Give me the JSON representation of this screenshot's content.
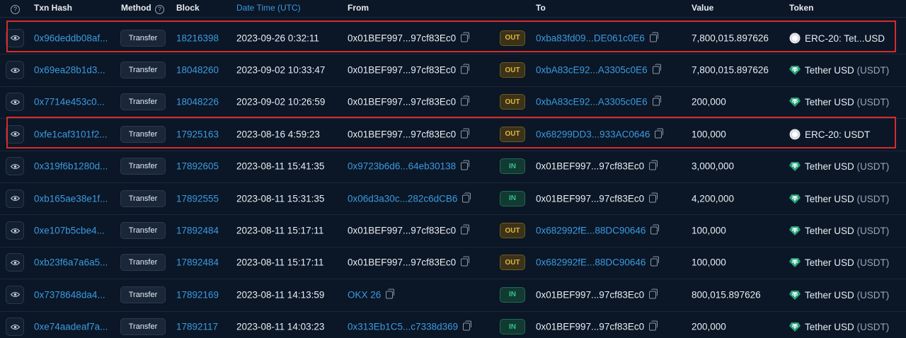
{
  "headers": {
    "help_icon": "question-circle-icon",
    "txn_hash": "Txn Hash",
    "method": "Method",
    "block": "Block",
    "date_time": "Date Time (UTC)",
    "from": "From",
    "to": "To",
    "value": "Value",
    "token": "Token"
  },
  "colors": {
    "link": "#3a9be0",
    "out_badge": "#e3b341",
    "in_badge": "#2fc29a",
    "highlight": "#d62b2b",
    "tether": "#26a17b"
  },
  "rows": [
    {
      "hash": "0x96deddb08af...",
      "method": "Transfer",
      "block": "18216398",
      "datetime": "2023-09-26 0:32:11",
      "from": "0x01BEF997...97cf83Ec0",
      "from_link": false,
      "dir": "OUT",
      "to": "0xba83fd09...DE061c0E6",
      "to_link": true,
      "value": "7,800,015.897626",
      "token": "ERC-20: Tet...USD",
      "token_sym": "",
      "token_icon": "erc20-circle-icon"
    },
    {
      "hash": "0x69ea28b1d3...",
      "method": "Transfer",
      "block": "18048260",
      "datetime": "2023-09-02 10:33:47",
      "from": "0x01BEF997...97cf83Ec0",
      "from_link": false,
      "dir": "OUT",
      "to": "0xbA83cE92...A3305c0E6",
      "to_link": true,
      "value": "7,800,015.897626",
      "token": "Tether USD",
      "token_sym": "(USDT)",
      "token_icon": "tether-icon"
    },
    {
      "hash": "0x7714e453c0...",
      "method": "Transfer",
      "block": "18048226",
      "datetime": "2023-09-02 10:26:59",
      "from": "0x01BEF997...97cf83Ec0",
      "from_link": false,
      "dir": "OUT",
      "to": "0xbA83cE92...A3305c0E6",
      "to_link": true,
      "value": "200,000",
      "token": "Tether USD",
      "token_sym": "(USDT)",
      "token_icon": "tether-icon"
    },
    {
      "hash": "0xfe1caf3101f2...",
      "method": "Transfer",
      "block": "17925163",
      "datetime": "2023-08-16 4:59:23",
      "from": "0x01BEF997...97cf83Ec0",
      "from_link": false,
      "dir": "OUT",
      "to": "0x68299DD3...933AC0646",
      "to_link": true,
      "value": "100,000",
      "token": "ERC-20: USDT",
      "token_sym": "",
      "token_icon": "erc20-circle-icon"
    },
    {
      "hash": "0x319f6b1280d...",
      "method": "Transfer",
      "block": "17892605",
      "datetime": "2023-08-11 15:41:35",
      "from": "0x9723b6d6...64eb30138",
      "from_link": true,
      "dir": "IN",
      "to": "0x01BEF997...97cf83Ec0",
      "to_link": false,
      "value": "3,000,000",
      "token": "Tether USD",
      "token_sym": "(USDT)",
      "token_icon": "tether-icon"
    },
    {
      "hash": "0xb165ae38e1f...",
      "method": "Transfer",
      "block": "17892555",
      "datetime": "2023-08-11 15:31:35",
      "from": "0x06d3a30c...282c6dCB6",
      "from_link": true,
      "dir": "IN",
      "to": "0x01BEF997...97cf83Ec0",
      "to_link": false,
      "value": "4,200,000",
      "token": "Tether USD",
      "token_sym": "(USDT)",
      "token_icon": "tether-icon"
    },
    {
      "hash": "0xe107b5cbe4...",
      "method": "Transfer",
      "block": "17892484",
      "datetime": "2023-08-11 15:17:11",
      "from": "0x01BEF997...97cf83Ec0",
      "from_link": false,
      "dir": "OUT",
      "to": "0x682992fE...88DC90646",
      "to_link": true,
      "value": "100,000",
      "token": "Tether USD",
      "token_sym": "(USDT)",
      "token_icon": "tether-icon"
    },
    {
      "hash": "0xb23f6a7a6a5...",
      "method": "Transfer",
      "block": "17892484",
      "datetime": "2023-08-11 15:17:11",
      "from": "0x01BEF997...97cf83Ec0",
      "from_link": false,
      "dir": "OUT",
      "to": "0x682992fE...88DC90646",
      "to_link": true,
      "value": "100,000",
      "token": "Tether USD",
      "token_sym": "(USDT)",
      "token_icon": "tether-icon"
    },
    {
      "hash": "0x7378648da4...",
      "method": "Transfer",
      "block": "17892169",
      "datetime": "2023-08-11 14:13:59",
      "from": "OKX 26",
      "from_link": true,
      "dir": "IN",
      "to": "0x01BEF997...97cf83Ec0",
      "to_link": false,
      "value": "800,015.897626",
      "token": "Tether USD",
      "token_sym": "(USDT)",
      "token_icon": "tether-icon"
    },
    {
      "hash": "0xe74aadeaf7a...",
      "method": "Transfer",
      "block": "17892117",
      "datetime": "2023-08-11 14:03:23",
      "from": "0x313Eb1C5...c7338d369",
      "from_link": true,
      "dir": "IN",
      "to": "0x01BEF997...97cf83Ec0",
      "to_link": false,
      "value": "200,000",
      "token": "Tether USD",
      "token_sym": "(USDT)",
      "token_icon": "tether-icon"
    }
  ],
  "highlighted_rows": [
    0,
    3
  ]
}
